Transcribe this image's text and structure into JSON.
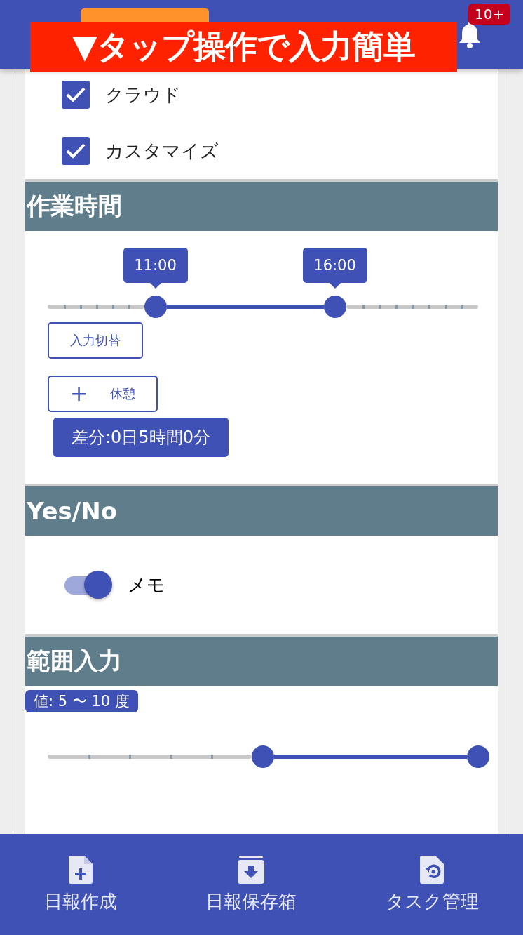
{
  "header": {
    "notification_badge": "10+"
  },
  "overlay_banner": {
    "text": "▼タップ操作で入力簡単"
  },
  "checkboxes": [
    {
      "label": "クラウド",
      "checked": true
    },
    {
      "label": "カスタマイズ",
      "checked": true
    }
  ],
  "work_time": {
    "title": "作業時間",
    "range": {
      "start": {
        "level": 0.25,
        "label": "11:00"
      },
      "end": {
        "level": 0.667,
        "label": "16:00"
      }
    },
    "switch_button": "入力切替",
    "break_button": {
      "icon": "+",
      "label": "休憩"
    },
    "difference": "差分:0日5時間0分"
  },
  "yes_no": {
    "title": "Yes/No",
    "toggle": {
      "label": "メモ",
      "on": true
    }
  },
  "range_input": {
    "title": "範囲入力",
    "value_label": "値: 5 〜 10 度",
    "range": {
      "start": {
        "level": 0.5
      },
      "end": {
        "level": 1.0
      }
    }
  },
  "bottom_nav": [
    {
      "kind": "create",
      "label": "日報作成"
    },
    {
      "kind": "archive",
      "label": "日報保存箱"
    },
    {
      "kind": "tasks",
      "label": "タスク管理"
    }
  ]
}
